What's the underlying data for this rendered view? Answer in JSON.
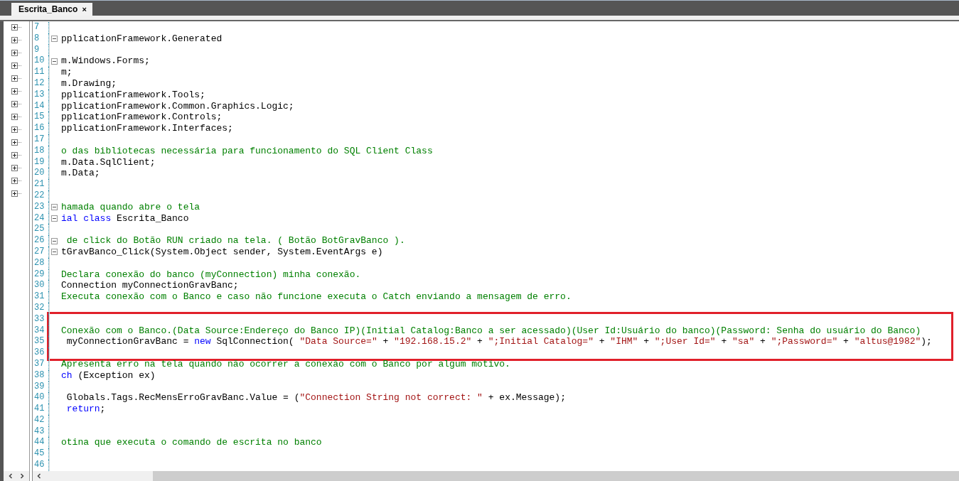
{
  "tabs": [
    {
      "label": "Escrita_Banco",
      "close": "×",
      "selected": true
    }
  ],
  "outline": {
    "nodes": [
      {
        "expanded": false
      },
      {
        "expanded": false
      },
      {
        "expanded": false
      },
      {
        "expanded": false
      },
      {
        "expanded": false
      },
      {
        "expanded": false
      },
      {
        "expanded": false
      },
      {
        "expanded": false
      },
      {
        "expanded": false
      },
      {
        "expanded": false
      },
      {
        "expanded": false
      },
      {
        "expanded": false
      },
      {
        "expanded": false
      },
      {
        "expanded": false
      }
    ]
  },
  "lines": [
    {
      "num": "7",
      "collapsible": false,
      "boxed": false
    },
    {
      "num": "8",
      "collapsible": true,
      "boxed": false,
      "tokens": [
        {
          "kind": "plain",
          "text": "pplicationFramework.Generated"
        }
      ]
    },
    {
      "num": "9",
      "collapsible": false,
      "boxed": false
    },
    {
      "num": "10",
      "collapsible": true,
      "boxed": false,
      "tokens": [
        {
          "kind": "plain",
          "text": "m.Windows.Forms;"
        }
      ]
    },
    {
      "num": "11",
      "collapsible": false,
      "boxed": false,
      "tokens": [
        {
          "kind": "plain",
          "text": "m;"
        }
      ]
    },
    {
      "num": "12",
      "collapsible": false,
      "boxed": false,
      "tokens": [
        {
          "kind": "plain",
          "text": "m.Drawing;"
        }
      ]
    },
    {
      "num": "13",
      "collapsible": false,
      "boxed": false,
      "tokens": [
        {
          "kind": "plain",
          "text": "pplicationFramework.Tools;"
        }
      ]
    },
    {
      "num": "14",
      "collapsible": false,
      "boxed": false,
      "tokens": [
        {
          "kind": "plain",
          "text": "pplicationFramework.Common.Graphics.Logic;"
        }
      ]
    },
    {
      "num": "15",
      "collapsible": false,
      "boxed": false,
      "tokens": [
        {
          "kind": "plain",
          "text": "pplicationFramework.Controls;"
        }
      ]
    },
    {
      "num": "16",
      "collapsible": false,
      "boxed": false,
      "tokens": [
        {
          "kind": "plain",
          "text": "pplicationFramework.Interfaces;"
        }
      ]
    },
    {
      "num": "17",
      "collapsible": false,
      "boxed": false
    },
    {
      "num": "18",
      "collapsible": false,
      "boxed": false,
      "tokens": [
        {
          "kind": "comment",
          "text": "o das bibliotecas necessária para funcionamento do SQL Client Class"
        }
      ]
    },
    {
      "num": "19",
      "collapsible": false,
      "boxed": false,
      "tokens": [
        {
          "kind": "plain",
          "text": "m.Data.SqlClient;"
        }
      ]
    },
    {
      "num": "20",
      "collapsible": false,
      "boxed": false,
      "tokens": [
        {
          "kind": "plain",
          "text": "m.Data;"
        }
      ]
    },
    {
      "num": "21",
      "collapsible": false,
      "boxed": false
    },
    {
      "num": "22",
      "collapsible": false,
      "boxed": false
    },
    {
      "num": "23",
      "collapsible": true,
      "boxed": false,
      "tokens": [
        {
          "kind": "comment",
          "text": "hamada quando abre o tela"
        }
      ]
    },
    {
      "num": "24",
      "collapsible": true,
      "boxed": false,
      "tokens": [
        {
          "kind": "keyword",
          "text": "ial class"
        },
        {
          "kind": "plain",
          "text": " Escrita_Banco"
        }
      ]
    },
    {
      "num": "25",
      "collapsible": false,
      "boxed": false
    },
    {
      "num": "26",
      "collapsible": true,
      "boxed": false,
      "tokens": [
        {
          "kind": "comment",
          "text": " de click do Botão RUN criado na tela. ( Botão BotGravBanco )."
        }
      ]
    },
    {
      "num": "27",
      "collapsible": true,
      "boxed": false,
      "tokens": [
        {
          "kind": "plain",
          "text": "tGravBanco_Click(System.Object sender, System.EventArgs e)"
        }
      ]
    },
    {
      "num": "28",
      "collapsible": false,
      "boxed": false
    },
    {
      "num": "29",
      "collapsible": false,
      "boxed": false,
      "tokens": [
        {
          "kind": "comment",
          "text": "Declara conexão do banco (myConnection) minha conexão."
        }
      ]
    },
    {
      "num": "30",
      "collapsible": false,
      "boxed": false,
      "tokens": [
        {
          "kind": "plain",
          "text": "Connection myConnectionGravBanc;"
        }
      ]
    },
    {
      "num": "31",
      "collapsible": false,
      "boxed": false,
      "tokens": [
        {
          "kind": "comment",
          "text": "Executa conexão com o Banco e caso não funcione executa o Catch enviando a mensagem de erro."
        }
      ]
    },
    {
      "num": "32",
      "collapsible": false,
      "boxed": false
    },
    {
      "num": "33",
      "collapsible": false,
      "boxed": true
    },
    {
      "num": "34",
      "collapsible": false,
      "boxed": true,
      "tokens": [
        {
          "kind": "comment",
          "text": "Conexão com o Banco.(Data Source:Endereço do Banco IP)(Initial Catalog:Banco a ser acessado)(User Id:Usuário do banco)(Password: Senha do usuário do Banco)"
        }
      ]
    },
    {
      "num": "35",
      "collapsible": false,
      "boxed": true,
      "tokens": [
        {
          "kind": "plain",
          "text": " myConnectionGravBanc = "
        },
        {
          "kind": "keyword",
          "text": "new"
        },
        {
          "kind": "plain",
          "text": " SqlConnection( "
        },
        {
          "kind": "string",
          "text": "\"Data Source=\""
        },
        {
          "kind": "plain",
          "text": " + "
        },
        {
          "kind": "string",
          "text": "\"192.168.15.2\""
        },
        {
          "kind": "plain",
          "text": " + "
        },
        {
          "kind": "string",
          "text": "\";Initial Catalog=\""
        },
        {
          "kind": "plain",
          "text": " + "
        },
        {
          "kind": "string",
          "text": "\"IHM\""
        },
        {
          "kind": "plain",
          "text": " + "
        },
        {
          "kind": "string",
          "text": "\";User Id=\""
        },
        {
          "kind": "plain",
          "text": " + "
        },
        {
          "kind": "string",
          "text": "\"sa\""
        },
        {
          "kind": "plain",
          "text": " + "
        },
        {
          "kind": "string",
          "text": "\";Password=\""
        },
        {
          "kind": "plain",
          "text": " + "
        },
        {
          "kind": "string",
          "text": "\"altus@1982\""
        },
        {
          "kind": "plain",
          "text": ");"
        }
      ]
    },
    {
      "num": "36",
      "collapsible": false,
      "boxed": true
    },
    {
      "num": "37",
      "collapsible": false,
      "boxed": false,
      "tokens": [
        {
          "kind": "comment",
          "text": "Apresenta erro na tela quando não ocorrer a conexão com o Banco por algum motivo."
        }
      ]
    },
    {
      "num": "38",
      "collapsible": false,
      "boxed": false,
      "tokens": [
        {
          "kind": "keyword",
          "text": "ch"
        },
        {
          "kind": "plain",
          "text": " (Exception ex)"
        }
      ]
    },
    {
      "num": "39",
      "collapsible": false,
      "boxed": false
    },
    {
      "num": "40",
      "collapsible": false,
      "boxed": false,
      "tokens": [
        {
          "kind": "plain",
          "text": " Globals.Tags.RecMensErroGravBanc.Value = ("
        },
        {
          "kind": "string",
          "text": "\"Connection String not correct: \""
        },
        {
          "kind": "plain",
          "text": " + ex.Message);"
        }
      ]
    },
    {
      "num": "41",
      "collapsible": false,
      "boxed": false,
      "tokens": [
        {
          "kind": "keyword",
          "text": " return"
        },
        {
          "kind": "plain",
          "text": ";"
        }
      ]
    },
    {
      "num": "42",
      "collapsible": false,
      "boxed": false
    },
    {
      "num": "43",
      "collapsible": false,
      "boxed": false
    },
    {
      "num": "44",
      "collapsible": false,
      "boxed": false,
      "tokens": [
        {
          "kind": "comment",
          "text": "otina que executa o comando de escrita no banco"
        }
      ]
    },
    {
      "num": "45",
      "collapsible": false,
      "boxed": false
    },
    {
      "num": "46",
      "collapsible": false,
      "boxed": false
    }
  ]
}
